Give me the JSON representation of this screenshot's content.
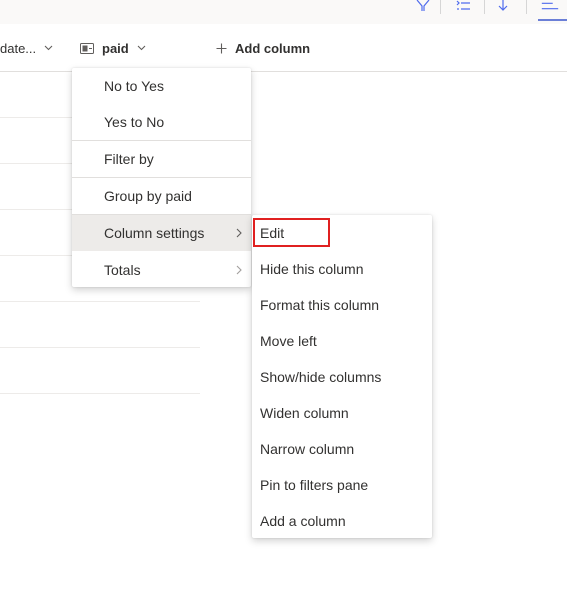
{
  "toolbar": {
    "icons": [
      "filter-icon",
      "list-options-icon",
      "sort-icon",
      "view-icon"
    ]
  },
  "header": {
    "date_column_label": "date...",
    "paid_column_label": "paid",
    "add_column_label": "Add column"
  },
  "main_menu": {
    "items": [
      {
        "label": "No to Yes"
      },
      {
        "label": "Yes to No"
      },
      {
        "label": "Filter by"
      },
      {
        "label": "Group by paid"
      },
      {
        "label": "Column settings",
        "has_submenu": true,
        "active": true
      },
      {
        "label": "Totals",
        "has_submenu": true
      }
    ]
  },
  "sub_menu": {
    "items": [
      {
        "label": "Edit",
        "highlighted": true
      },
      {
        "label": "Hide this column"
      },
      {
        "label": "Format this column"
      },
      {
        "label": "Move left"
      },
      {
        "label": "Show/hide columns"
      },
      {
        "label": "Widen column"
      },
      {
        "label": "Narrow column"
      },
      {
        "label": "Pin to filters pane"
      },
      {
        "label": "Add a column"
      }
    ]
  },
  "colors": {
    "highlight_border": "#e02020",
    "active_item_bg": "#edebe9",
    "accent": "#6b7fd7"
  }
}
